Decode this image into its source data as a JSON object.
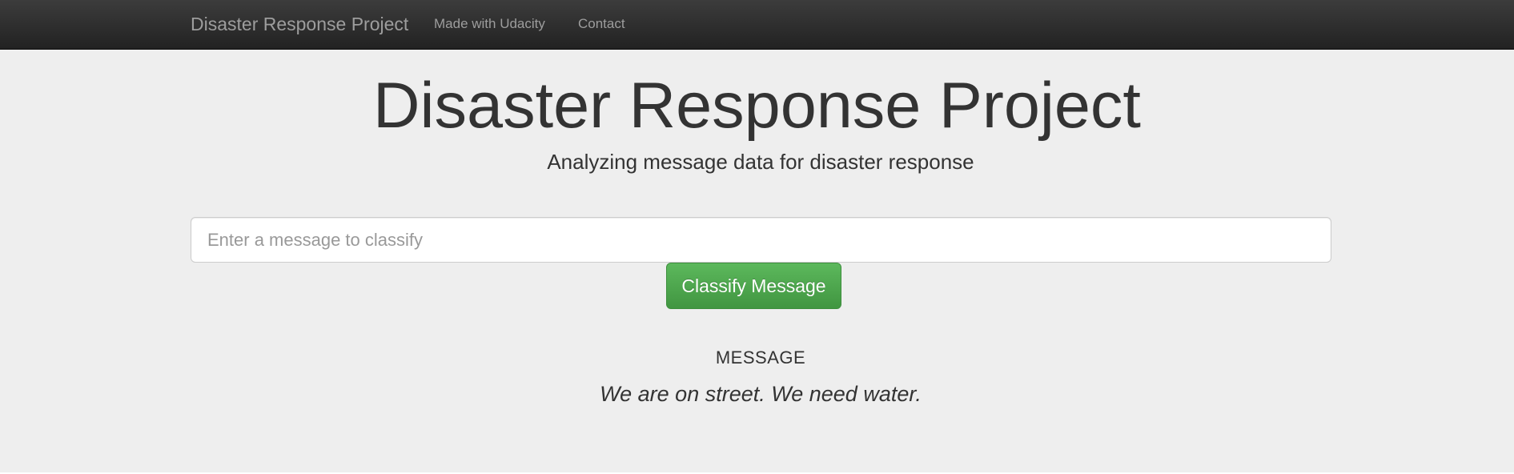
{
  "navbar": {
    "brand": "Disaster Response Project",
    "links": [
      {
        "label": "Made with Udacity"
      },
      {
        "label": "Contact"
      }
    ]
  },
  "header": {
    "title": "Disaster Response Project",
    "subtitle": "Analyzing message data for disaster response"
  },
  "form": {
    "input_value": "",
    "input_placeholder": "Enter a message to classify",
    "button_label": "Classify Message"
  },
  "result": {
    "heading": "MESSAGE",
    "message": "We are on street. We need water."
  },
  "colors": {
    "navbar_bg": "#222222",
    "nav_text": "#9d9d9d",
    "jumbotron_bg": "#eeeeee",
    "button_green": "#5cb85c",
    "text": "#333333"
  }
}
